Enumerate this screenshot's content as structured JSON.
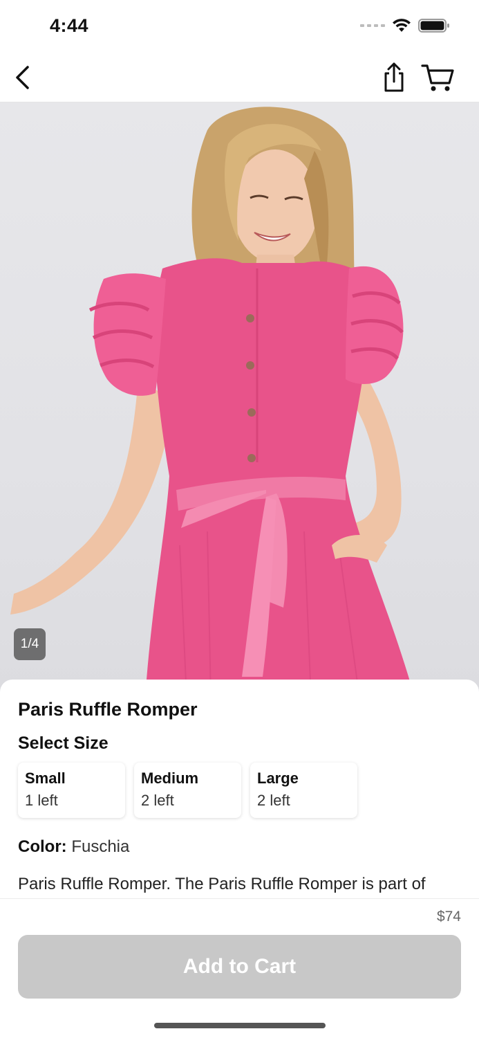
{
  "status_bar": {
    "time": "4:44"
  },
  "nav": {
    "back_icon": "chevron-left-icon",
    "share_icon": "share-icon",
    "cart_icon": "cart-icon"
  },
  "gallery": {
    "page_indicator": "1/4"
  },
  "product": {
    "title": "Paris Ruffle Romper",
    "select_size_label": "Select Size",
    "sizes": [
      {
        "name": "Small",
        "stock": "1 left"
      },
      {
        "name": "Medium",
        "stock": "2 left"
      },
      {
        "name": "Large",
        "stock": "2 left"
      }
    ],
    "color_label": "Color:",
    "color_value": "Fuschia",
    "description": "Paris Ruffle Romper. The Paris Ruffle Romper is part of"
  },
  "footer": {
    "price": "$74",
    "add_to_cart_label": "Add to Cart"
  },
  "colors": {
    "garment": "#e8538a",
    "button_disabled": "#c8c8c8"
  }
}
